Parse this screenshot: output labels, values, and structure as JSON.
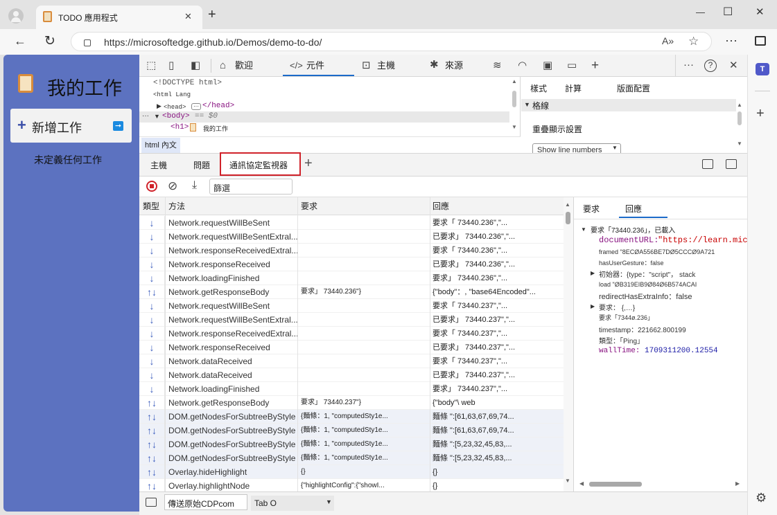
{
  "browser": {
    "tab_title": "TODO 應用程式",
    "new_tab": "+",
    "url": "https://microsoftedge.github.io/Demos/demo-to-do/",
    "minimize": "—",
    "maximize": "☐",
    "close": "✕"
  },
  "app": {
    "title": "我的工作",
    "add_task_label": "新增工作",
    "empty_message": "未定義任何工作"
  },
  "devtools": {
    "tabs": [
      "歡迎",
      "元件",
      "主機",
      "來源"
    ],
    "elements": {
      "line1": "<!DOCTYPE html>",
      "line2": "<html Lang",
      "line3_tag": "<head>",
      "line3_close": "</head>",
      "line4_tag": "<body>",
      "line4_eq": "== $0",
      "line5_tag": "<h1>",
      "line5_text": "我的工作",
      "breadcrumb": "html 內文"
    },
    "styles_tabs": [
      "樣式",
      "計算",
      "版面配置"
    ],
    "grid_section": "格線",
    "overlay_label": "重疊顯示設置",
    "overlay_select": "Show line numbers",
    "drawer_tabs": [
      "主機",
      "問題",
      "通訊協定監視器"
    ],
    "filter_placeholder": "篩選",
    "columns": [
      "類型",
      "方法",
      "要求",
      "回應"
    ],
    "rows": [
      {
        "type": "↓",
        "method": "Network.requestWillBeSent",
        "req": "",
        "resp": "要求「      73440.236\",\"..."
      },
      {
        "type": "↓",
        "method": "Network.requestWillBeSentExtral...",
        "req": "",
        "resp": "已要求」     73440.236\",\"..."
      },
      {
        "type": "↓",
        "method": "Network.responseReceivedExtral...",
        "req": "",
        "resp": "要求「      73440.236\",\"..."
      },
      {
        "type": "↓",
        "method": "Network.responseReceived",
        "req": "",
        "resp": "已要求」     73440.236\",\"..."
      },
      {
        "type": "↓",
        "method": "Network.loadingFinished",
        "req": "",
        "resp": "要求」        73440.236\",\"..."
      },
      {
        "type": "↑↓",
        "method": "Network.getResponseBody",
        "req": "要求」           73440.236\"}",
        "resp": "{\"body\"：, \"base64Encoded\"..."
      },
      {
        "type": "↓",
        "method": "Network.requestWillBeSent",
        "req": "",
        "resp": "要求「      73440.237\",\"..."
      },
      {
        "type": "↓",
        "method": "Network.requestWillBeSentExtral...",
        "req": "",
        "resp": "已要求」     73440.237\",\"..."
      },
      {
        "type": "↓",
        "method": "Network.responseReceivedExtral...",
        "req": "",
        "resp": "要求「      73440.237\",\"..."
      },
      {
        "type": "↓",
        "method": "Network.responseReceived",
        "req": "",
        "resp": "已要求」     73440.237\",\"..."
      },
      {
        "type": "↓",
        "method": "Network.dataReceived",
        "req": "",
        "resp": "要求「      73440.237\",\"..."
      },
      {
        "type": "↓",
        "method": "Network.dataReceived",
        "req": "",
        "resp": "已要求」     73440.237\",\"..."
      },
      {
        "type": "↓",
        "method": "Network.loadingFinished",
        "req": "",
        "resp": "要求」        73440.237\",\"..."
      },
      {
        "type": "↑↓",
        "method": "Network.getResponseBody",
        "req": "要求」           73440.237\"}",
        "resp": "{\"body\"\\ web"
      },
      {
        "type": "↑↓",
        "method": "DOM.getNodesForSubtreeByStyle",
        "req": "{麵條：1, \"computedSty1e...",
        "resp": "麵條   \":[61,63,67,69,74..."
      },
      {
        "type": "↑↓",
        "method": "DOM.getNodesForSubtreeByStyle",
        "req": "{麵條：1, \"computedSty1e...",
        "resp": "麵條   \":[61,63,67,69,74..."
      },
      {
        "type": "↑↓",
        "method": "DOM.getNodesForSubtreeByStyle",
        "req": "{麵條：1, \"computedSty1e...",
        "resp": "麵條   \":[5,23,32,45,83,..."
      },
      {
        "type": "↑↓",
        "method": "DOM.getNodesForSubtreeByStyle",
        "req": "{麵條：1, \"computedSty1e...",
        "resp": "麵條   \":[5,23,32,45,83,..."
      },
      {
        "type": "↑↓",
        "method": "Overlay.hideHighlight",
        "req": "{}",
        "resp": "{}"
      },
      {
        "type": "↑↓",
        "method": "Overlay.highlightNode",
        "req": "{\"highlightConfig\":{\"showI...",
        "resp": "{}"
      }
    ],
    "detail_tabs": [
      "要求",
      "回應"
    ],
    "detail": {
      "header": "要求「73440.236」，已載入",
      "documentURL_key": "documentURL:",
      "documentURL_val": "\"https://learn.micro",
      "frameId": "framed \"8ECØA556BE7DØ5CCCØ9A721",
      "hasUserGesture": "hasUserGesture：false",
      "initiator": "初始器：{type：\"script\"，  stack",
      "loaderId": "load \"ØB319EIB9Ø84Ø6B574ACAI",
      "redirect": "redirectHasExtraInfo：false",
      "request": "要求：       {,…}",
      "requestId": "要求「7344ø.236」",
      "timestamp": "timestamp：221662.800199",
      "type": "類型：「Ping」",
      "wallTime_key": "wallTime:",
      "wallTime_val": "1709311200.12554"
    },
    "bottom_input": "傳送原始CDPcom",
    "bottom_select": "Tab O"
  }
}
